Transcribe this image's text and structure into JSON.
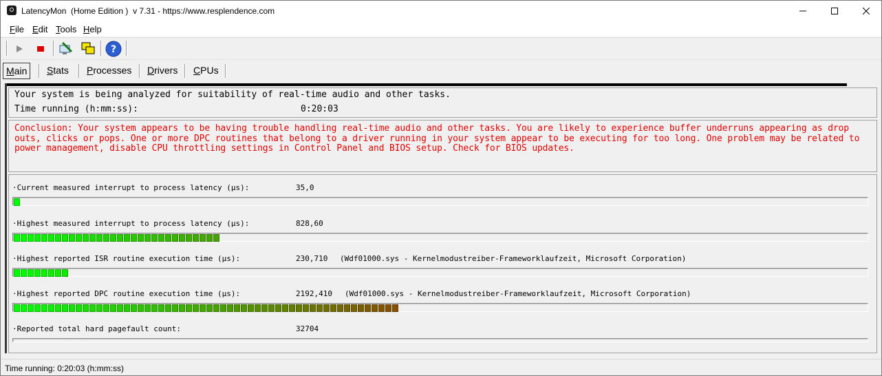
{
  "window": {
    "title": "LatencyMon  (Home Edition )  v 7.31 - https://www.resplendence.com",
    "controls": [
      "minimize",
      "maximize",
      "close"
    ]
  },
  "menu": [
    {
      "accel": "F",
      "rest": "ile"
    },
    {
      "accel": "E",
      "rest": "dit"
    },
    {
      "accel": "T",
      "rest": "ools"
    },
    {
      "accel": "H",
      "rest": "elp"
    }
  ],
  "toolbar": {
    "icons": [
      "play-icon",
      "stop-icon",
      "monitor-icon",
      "windows-icon",
      "help-icon"
    ]
  },
  "tabs": [
    {
      "accel": "M",
      "rest": "ain",
      "active": true
    },
    {
      "accel": "S",
      "rest": "tats",
      "active": false
    },
    {
      "accel": "P",
      "rest": "rocesses",
      "active": false
    },
    {
      "accel": "D",
      "rest": "rivers",
      "active": false
    },
    {
      "accel": "C",
      "rest": "PUs",
      "active": false
    }
  ],
  "summary": {
    "analysis_text": "Your system is being analyzed for suitability of real-time audio and other tasks.",
    "time_label": "Time running (h:mm:ss):",
    "time_value": "0:20:03"
  },
  "conclusion": {
    "text": "Conclusion: Your system appears to be having trouble handling real-time audio and other tasks. You are likely to experience buffer underruns appearing as drop outs, clicks or pops. One or more DPC routines that belong to a driver running in your system appear to be executing for too long. One problem may be related to power management, disable CPU throttling settings in Control Panel and BIOS setup. Check for BIOS updates.",
    "color": "#e00000"
  },
  "metrics": [
    {
      "label": "·Current measured interrupt to process latency (µs):",
      "value": "35,0",
      "detail": "",
      "bar_fraction": 0.008,
      "segments": 1
    },
    {
      "label": "·Highest measured interrupt to process latency (µs):",
      "value": "828,60",
      "detail": "",
      "bar_fraction": 0.24,
      "segments": 30
    },
    {
      "label": "·Highest reported ISR routine execution time (µs):",
      "value": "230,710",
      "detail": "(Wdf01000.sys - Kernelmodustreiber-Frameworklaufzeit, Microsoft Corporation)",
      "bar_fraction": 0.066,
      "segments": 8
    },
    {
      "label": "·Highest reported DPC routine execution time (µs):",
      "value": "2192,410",
      "detail": "(Wdf01000.sys - Kernelmodustreiber-Frameworklaufzeit, Microsoft Corporation)",
      "bar_fraction": 0.452,
      "segments": 56
    },
    {
      "label": "·Reported total hard pagefault count:",
      "value": "32704",
      "detail": "",
      "bar_fraction": 0,
      "segments": 0
    }
  ],
  "colors": {
    "bar_green": "#00ff00",
    "bar_brown": "#8b4a00"
  },
  "statusbar": {
    "text": "Time running: 0:20:03  (h:mm:ss)"
  }
}
